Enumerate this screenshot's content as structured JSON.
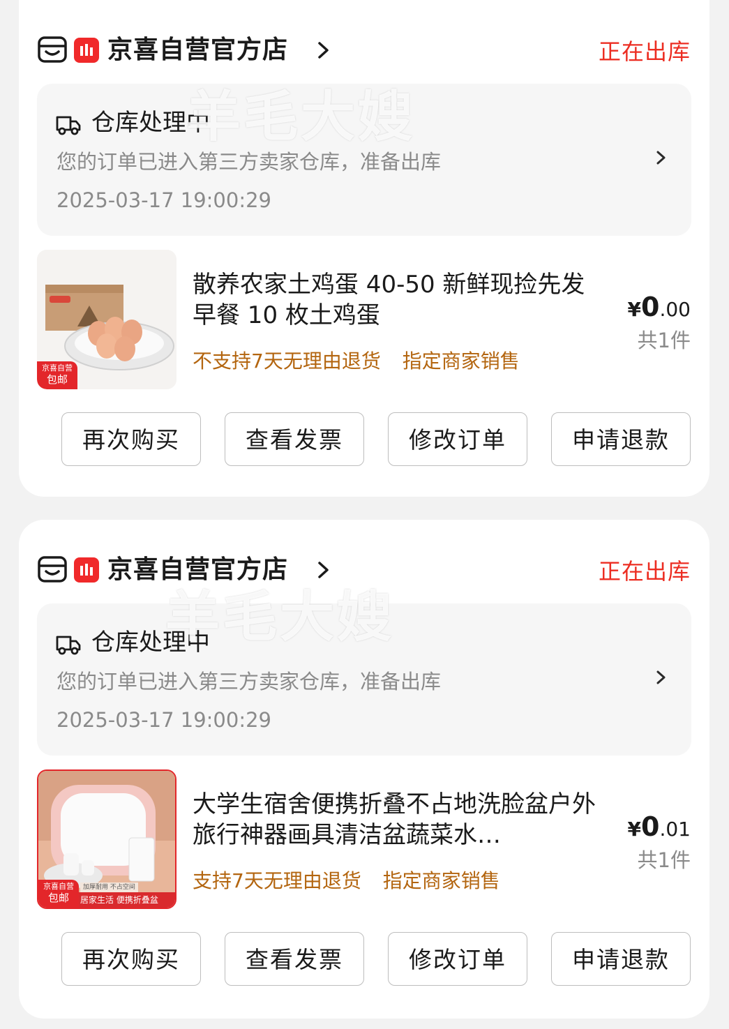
{
  "orders": [
    {
      "shop_name": "京喜自营官方店",
      "status": "正在出库",
      "logistics": {
        "title": "仓库处理中",
        "desc": "您的订单已进入第三方卖家仓库，准备出库",
        "time": "2025-03-17 19:00:29"
      },
      "product": {
        "title": "散养农家土鸡蛋 40-50 新鲜现捡先发早餐 10 枚土鸡蛋",
        "tags": [
          "不支持7天无理由退货",
          "指定商家销售"
        ],
        "badge_top": "京喜自营",
        "badge_bottom": "包邮",
        "price_currency": "¥",
        "price_int": "0",
        "price_dec": ".00",
        "quantity": "共1件"
      },
      "buttons": [
        "再次购买",
        "查看发票",
        "修改订单",
        "申请退款"
      ]
    },
    {
      "shop_name": "京喜自营官方店",
      "status": "正在出库",
      "logistics": {
        "title": "仓库处理中",
        "desc": "您的订单已进入第三方卖家仓库，准备出库",
        "time": "2025-03-17 19:00:29"
      },
      "product": {
        "title": "大学生宿舍便携折叠不占地洗脸盆户外旅行神器画具清洁盆蔬菜水…",
        "tags": [
          "支持7天无理由退货",
          "指定商家销售"
        ],
        "badge_top": "京喜自营",
        "badge_bottom": "包邮",
        "banner_small": "加厚耐用  不占空间",
        "banner_text": "居家生活 便携折叠盆",
        "price_currency": "¥",
        "price_int": "0",
        "price_dec": ".01",
        "quantity": "共1件"
      },
      "buttons": [
        "再次购买",
        "查看发票",
        "修改订单",
        "申请退款"
      ]
    }
  ],
  "watermark": "羊毛大嫂",
  "icons": {
    "shop": "store-icon",
    "logo": "jingxi-logo-icon",
    "logistics": "truck-icon",
    "chevron": "chevron-right-icon"
  },
  "colors": {
    "accent_red": "#ec2d22",
    "tag_brown": "#b3650f",
    "muted_text": "#8a8a8a"
  }
}
